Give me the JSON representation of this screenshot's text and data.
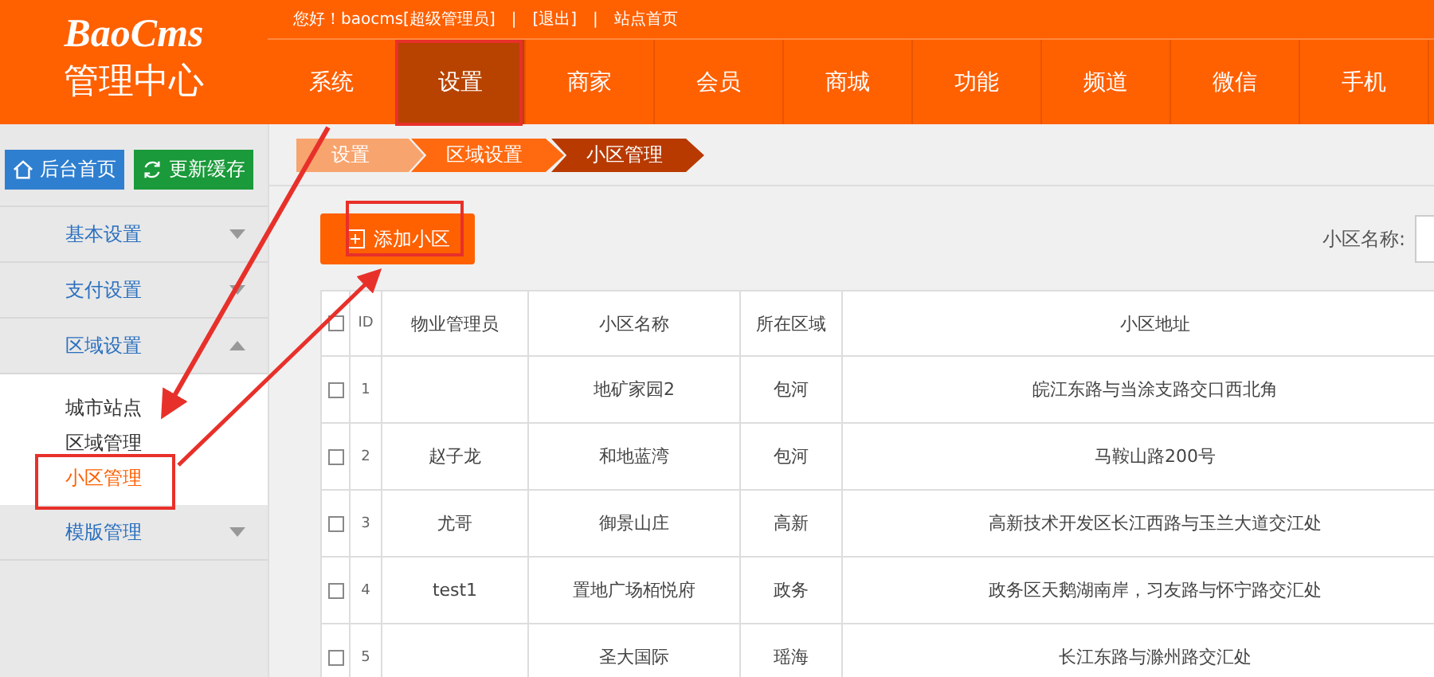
{
  "logo": {
    "brand": "BaoCms",
    "subtitle": "管理中心"
  },
  "top_links": [
    {
      "text": "您好！baocms[超级管理员]",
      "kind": "text"
    },
    {
      "text": "|",
      "kind": "sep"
    },
    {
      "text": "[退出]",
      "kind": "link"
    },
    {
      "text": "|",
      "kind": "sep"
    },
    {
      "text": "站点首页",
      "kind": "link"
    }
  ],
  "nav_tabs": [
    {
      "label": "系统",
      "selected": false
    },
    {
      "label": "设置",
      "selected": true
    },
    {
      "label": "商家",
      "selected": false
    },
    {
      "label": "会员",
      "selected": false
    },
    {
      "label": "商城",
      "selected": false
    },
    {
      "label": "功能",
      "selected": false
    },
    {
      "label": "频道",
      "selected": false
    },
    {
      "label": "微信",
      "selected": false
    },
    {
      "label": "手机",
      "selected": false
    }
  ],
  "sidebar": {
    "buttons": [
      {
        "label": "后台首页",
        "kind": "home"
      },
      {
        "label": "更新缓存",
        "kind": "refresh"
      }
    ],
    "items": [
      {
        "label": "基本设置",
        "expanded": false
      },
      {
        "label": "支付设置",
        "expanded": false
      },
      {
        "label": "区域设置",
        "expanded": true,
        "children": [
          {
            "label": "城市站点",
            "selected": false
          },
          {
            "label": "区域管理",
            "selected": false
          },
          {
            "label": "小区管理",
            "selected": true
          }
        ]
      },
      {
        "label": "模版管理",
        "expanded": false
      }
    ]
  },
  "breadcrumb": [
    {
      "label": "设置",
      "selected": false
    },
    {
      "label": "区域设置",
      "selected": false
    },
    {
      "label": "小区管理",
      "selected": true
    }
  ],
  "add_button": "添加小区",
  "search": {
    "label": "小区名称:"
  },
  "table": {
    "columns": [
      "ID",
      "物业管理员",
      "小区名称",
      "所在区域",
      "小区地址"
    ],
    "header_checked": false,
    "rows": [
      {
        "checked": false,
        "cells": [
          "1",
          "",
          "地矿家园2",
          "包河",
          "皖江东路与当涂支路交口西北角"
        ]
      },
      {
        "checked": false,
        "cells": [
          "2",
          "赵子龙",
          "和地蓝湾",
          "包河",
          "马鞍山路200号"
        ]
      },
      {
        "checked": false,
        "cells": [
          "3",
          "尤哥",
          "御景山庄",
          "高新",
          "高新技术开发区长江西路与玉兰大道交江处"
        ]
      },
      {
        "checked": false,
        "cells": [
          "4",
          "test1",
          "置地广场栢悦府",
          "政务",
          "政务区天鹅湖南岸，习友路与怀宁路交汇处"
        ]
      },
      {
        "checked": false,
        "cells": [
          "5",
          "",
          "圣大国际",
          "瑶海",
          "长江东路与滁州路交汇处"
        ]
      }
    ]
  }
}
